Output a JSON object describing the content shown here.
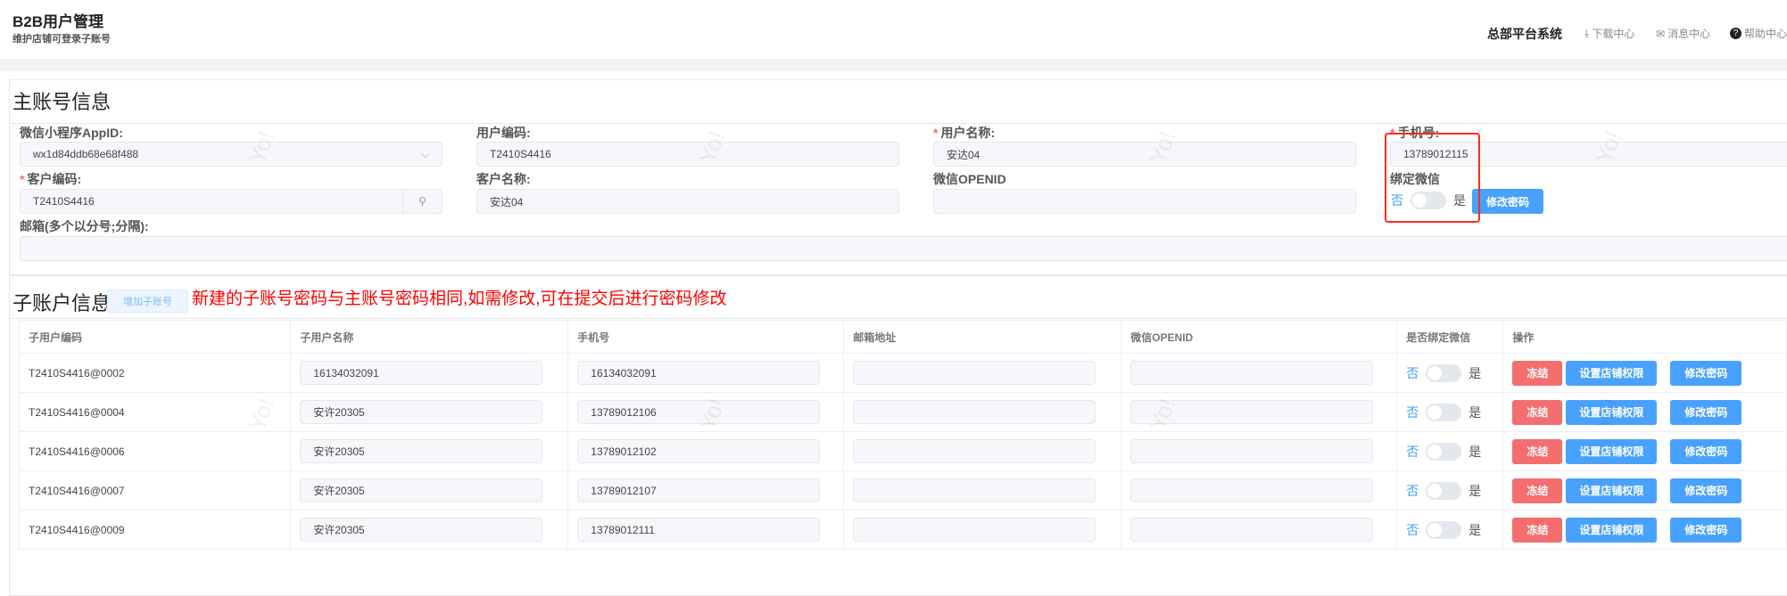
{
  "header": {
    "title": "B2B用户管理",
    "subtitle": "维护店铺可登录子账号",
    "system": "总部平台系统",
    "links": [
      {
        "label": "下载中心",
        "icon": "download-icon"
      },
      {
        "label": "消息中心",
        "icon": "mail-icon"
      },
      {
        "label": "帮助中心",
        "icon": "help-icon"
      }
    ]
  },
  "main": {
    "title": "主账号信息",
    "appid": {
      "label": "微信小程序AppID:",
      "value": "wx1d84ddb68e68f488"
    },
    "user_code": {
      "label": "用户编码:",
      "value": "T2410S4416"
    },
    "user_name": {
      "label": "用户名称:",
      "value": "安达04",
      "required": true
    },
    "phone": {
      "label": "手机号:",
      "value": "13789012115",
      "required": true
    },
    "customer_code": {
      "label": "客户编码:",
      "value": "T2410S4416",
      "required": true
    },
    "customer_name": {
      "label": "客户名称:",
      "value": "安达04"
    },
    "openid": {
      "label": "微信OPENID",
      "value": ""
    },
    "bind_wechat": {
      "label": "绑定微信",
      "no": "否",
      "yes": "是",
      "on": false
    },
    "change_password": "修改密码",
    "email": {
      "label": "邮箱(多个以分号;分隔):",
      "value": ""
    }
  },
  "sub": {
    "title": "子账户信息",
    "add_button": "增加子账号",
    "notice": "新建的子账号密码与主账号密码相同,如需修改,可在提交后进行密码修改",
    "notice_color": "#ff0000",
    "columns": [
      "子用户编码",
      "子用户名称",
      "手机号",
      "邮箱地址",
      "微信OPENID",
      "是否绑定微信",
      "操作"
    ],
    "toggle": {
      "no": "否",
      "yes": "是"
    },
    "actions": {
      "freeze": "冻结",
      "set_store": "设置店铺权限",
      "change_password": "修改密码"
    },
    "rows": [
      {
        "code": "T2410S4416@0002",
        "name": "16134032091",
        "phone": "16134032091",
        "email": "",
        "openid": "",
        "bound": false
      },
      {
        "code": "T2410S4416@0004",
        "name": "安许20305",
        "phone": "13789012106",
        "email": "",
        "openid": "",
        "bound": false
      },
      {
        "code": "T2410S4416@0006",
        "name": "安许20305",
        "phone": "13789012102",
        "email": "",
        "openid": "",
        "bound": false
      },
      {
        "code": "T2410S4416@0007",
        "name": "安许20305",
        "phone": "13789012107",
        "email": "",
        "openid": "",
        "bound": false
      },
      {
        "code": "T2410S4416@0009",
        "name": "安许20305",
        "phone": "13789012111",
        "email": "",
        "openid": "",
        "bound": false
      }
    ]
  },
  "watermark": "Yo!"
}
